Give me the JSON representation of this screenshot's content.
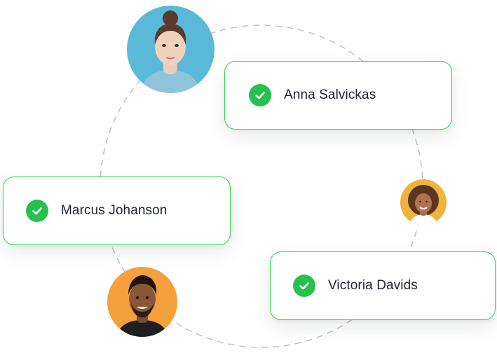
{
  "people": [
    {
      "name": "Anna Salvickas",
      "verified": true
    },
    {
      "name": "Marcus Johanson",
      "verified": true
    },
    {
      "name": "Victoria Davids",
      "verified": true
    }
  ],
  "colors": {
    "accent": "#25c04e",
    "card_border": "#3ccf5b",
    "text": "#1f2235",
    "orbit_line": "#bdbdbd",
    "avatar_anna_bg": "#5ab9d9",
    "avatar_victoria_bg": "#f0b43c",
    "avatar_marcus_bg": "#f3a03d"
  },
  "icons": {
    "check": "check-circle-icon"
  }
}
